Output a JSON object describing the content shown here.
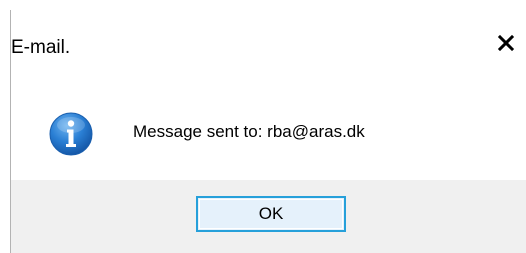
{
  "dialog": {
    "title": "E-mail.",
    "message": "Message sent to: rba@aras.dk",
    "icon": "info-icon",
    "close_icon": "close-icon",
    "ok_label": "OK"
  },
  "colors": {
    "accent_border": "#26a0da",
    "button_fill": "#e5f1fb",
    "footer_bg": "#f0f0f0",
    "info_blue": "#1e6fc4"
  }
}
